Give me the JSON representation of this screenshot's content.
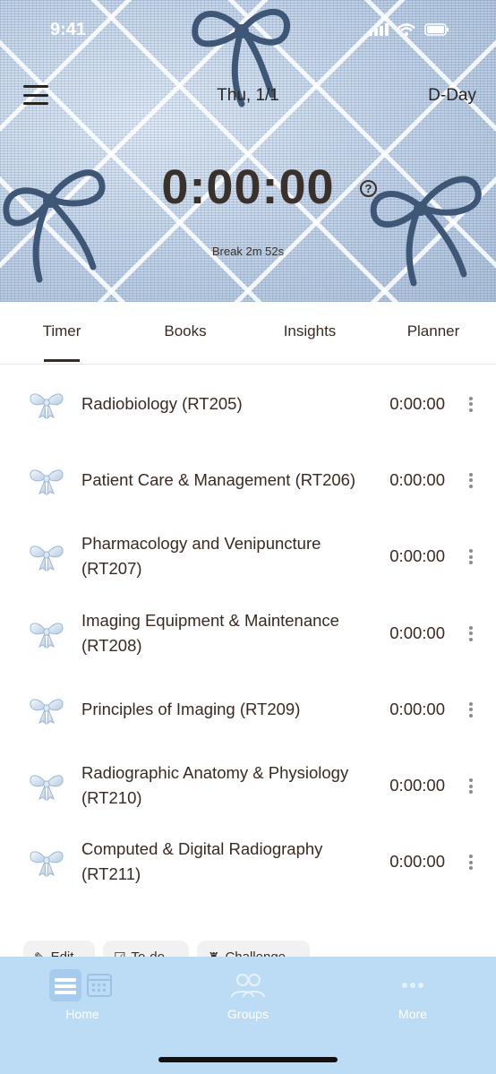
{
  "status_bar": {
    "time": "9:41"
  },
  "header": {
    "date": "Thu, 1/1",
    "dday": "D-Day",
    "total_time": "0:00:00",
    "break_text": "Break 2m 52s",
    "help_glyph": "?"
  },
  "tabs": [
    {
      "label": "Timer",
      "active": true
    },
    {
      "label": "Books",
      "active": false
    },
    {
      "label": "Insights",
      "active": false
    },
    {
      "label": "Planner",
      "active": false
    }
  ],
  "subjects": [
    {
      "name": "Radiobiology (RT205)",
      "time": "0:00:00",
      "icon": "ribbon-bow-icon"
    },
    {
      "name": "Patient Care & Management (RT206)",
      "time": "0:00:00",
      "icon": "ribbon-bow-icon"
    },
    {
      "name": "Pharmacology and Venipuncture (RT207)",
      "time": "0:00:00",
      "icon": "ribbon-bow-icon"
    },
    {
      "name": "Imaging Equipment & Maintenance (RT208)",
      "time": "0:00:00",
      "icon": "ribbon-bow-icon"
    },
    {
      "name": "Principles of Imaging (RT209)",
      "time": "0:00:00",
      "icon": "ribbon-bow-icon"
    },
    {
      "name": "Radiographic Anatomy & Physiology (RT210)",
      "time": "0:00:00",
      "icon": "ribbon-bow-icon"
    },
    {
      "name": "Computed & Digital Radiography (RT211)",
      "time": "0:00:00",
      "icon": "ribbon-bow-icon"
    }
  ],
  "actions": {
    "edit": "Edit",
    "todo": "To-do",
    "challenge": "Challenge"
  },
  "bottom_nav": {
    "home": "Home",
    "groups": "Groups",
    "more": "More"
  },
  "colors": {
    "text": "#3a2a22",
    "nav_background": "#bcdcf6",
    "header_denim": "#b7c9df"
  }
}
